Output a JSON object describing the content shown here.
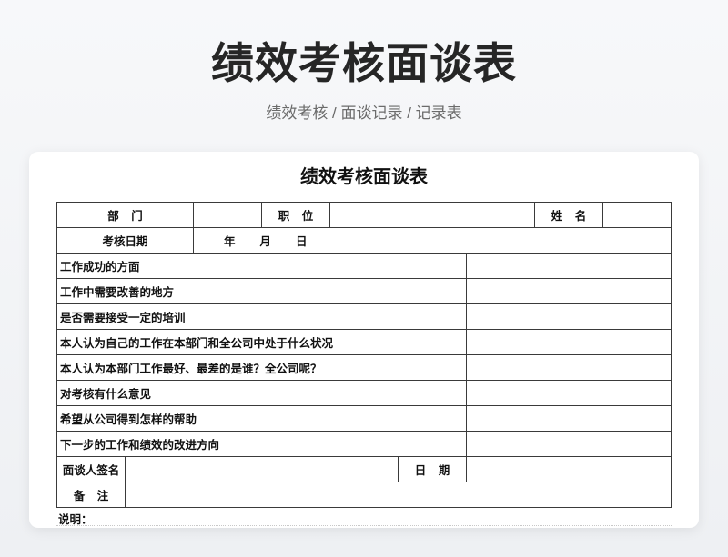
{
  "page": {
    "title": "绩效考核面谈表",
    "subtitle": "绩效考核 / 面谈记录 / 记录表"
  },
  "form": {
    "title": "绩效考核面谈表",
    "basic_info": {
      "department_label": "部 门",
      "position_label": "职 位",
      "name_label": "姓 名"
    },
    "review_date": {
      "label": "考核日期",
      "year": "年",
      "month": "月",
      "day": "日"
    },
    "questions": [
      "工作成功的方面",
      "工作中需要改善的地方",
      "是否需要接受一定的培训",
      "本人认为自己的工作在本部门和全公司中处于什么状况",
      "本人认为本部门工作最好、最差的是谁？全公司呢？",
      "对考核有什么意见",
      "希望从公司得到怎样的帮助",
      "下一步的工作和绩效的改进方向"
    ],
    "signature": {
      "interviewer_label": "面谈人签名",
      "date_label": "日 期"
    },
    "remarks_label": "备 注",
    "notes_label": "说明："
  },
  "colors": {
    "page_background": "#f4f5f7",
    "card_background": "#ffffff",
    "title_text": "#262626",
    "subtitle_text": "#6b6b6b",
    "table_border": "#3a3a3a"
  }
}
